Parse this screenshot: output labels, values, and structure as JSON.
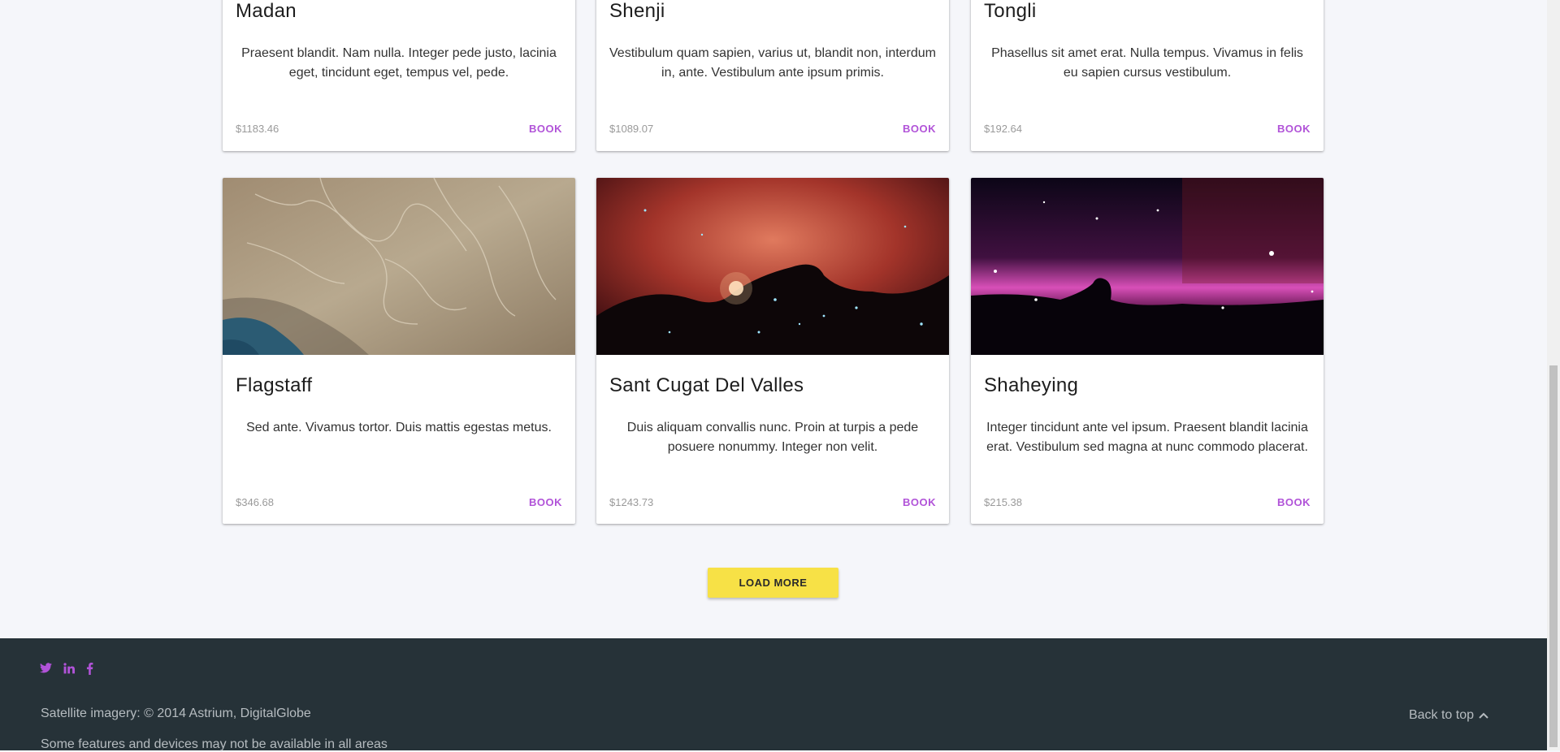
{
  "cards_top": [
    {
      "title": "Madan",
      "desc": "Praesent blandit. Nam nulla. Integer pede justo, lacinia eget, tincidunt eget, tempus vel, pede.",
      "price": "$1183.46",
      "book": "BOOK"
    },
    {
      "title": "Shenji",
      "desc": "Vestibulum quam sapien, varius ut, blandit non, interdum in, ante. Vestibulum ante ipsum primis.",
      "price": "$1089.07",
      "book": "BOOK"
    },
    {
      "title": "Tongli",
      "desc": "Phasellus sit amet erat. Nulla tempus. Vivamus in felis eu sapien cursus vestibulum.",
      "price": "$192.64",
      "book": "BOOK"
    }
  ],
  "cards_bottom": [
    {
      "title": "Flagstaff",
      "desc": "Sed ante. Vivamus tortor. Duis mattis egestas metus.",
      "price": "$346.68",
      "book": "BOOK",
      "image": "satellite-terrain-image"
    },
    {
      "title": "Sant Cugat Del Valles",
      "desc": "Duis aliquam convallis nunc. Proin at turpis a pede posuere nonummy. Integer non velit.",
      "price": "$1243.73",
      "book": "BOOK",
      "image": "red-nebula-image"
    },
    {
      "title": "Shaheying",
      "desc": "Integer tincidunt ante vel ipsum. Praesent blandit lacinia erat. Vestibulum sed magna at nunc commodo placerat.",
      "price": "$215.38",
      "book": "BOOK",
      "image": "horsehead-nebula-image"
    }
  ],
  "load_more": "LOAD MORE",
  "footer": {
    "social": [
      "twitter-icon",
      "linkedin-icon",
      "facebook-icon"
    ],
    "imagery_credit": "Satellite imagery: © 2014 Astrium, DigitalGlobe",
    "disclaimer": "Some features and devices may not be available in all areas",
    "back_to_top": "Back to top"
  },
  "colors": {
    "accent": "#b153d8",
    "button": "#f7e146",
    "footer_bg": "#263238",
    "page_bg": "#f5f6fa"
  }
}
